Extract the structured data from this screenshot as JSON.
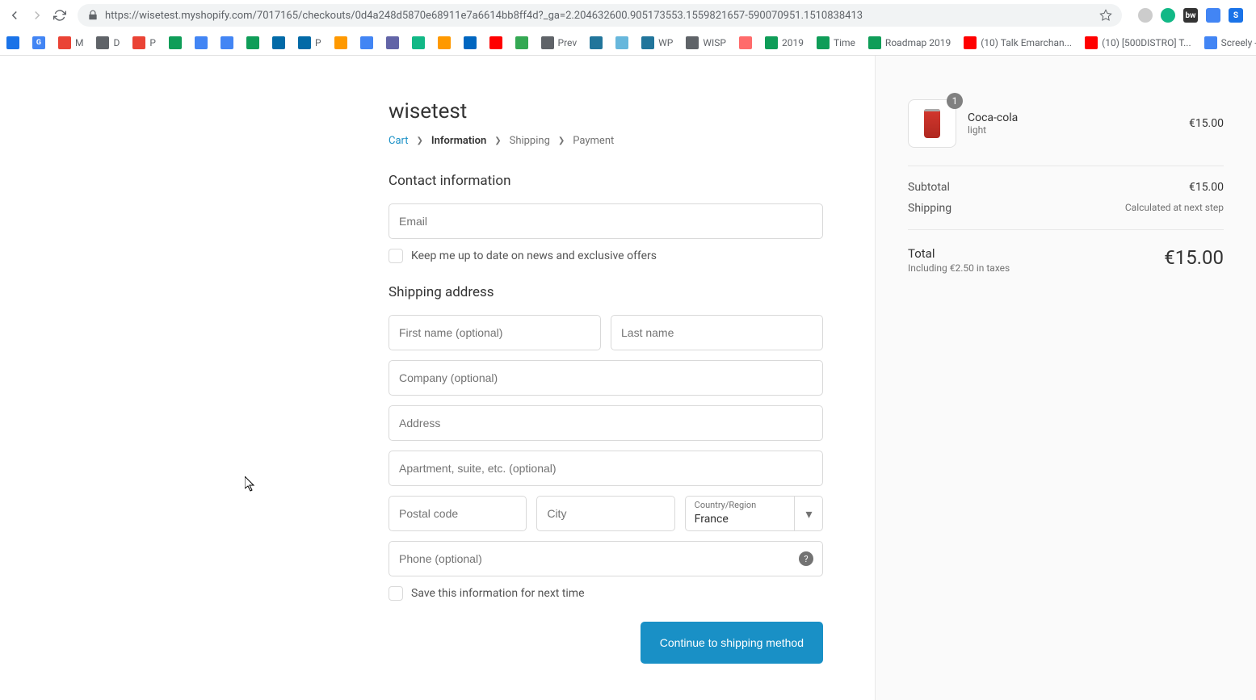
{
  "browser": {
    "url": "https://wisetest.myshopify.com/7017165/checkouts/0d4a248d5870e68911e7a6614bb8ff4d?_ga=2.204632600.905173553.1559821657-590070951.1510838413"
  },
  "bookmarks": [
    {
      "label": "",
      "color": "#1a73e8"
    },
    {
      "label": "",
      "color": "#4285f4",
      "text": "G"
    },
    {
      "label": "M",
      "color": "#ea4335"
    },
    {
      "label": "D",
      "color": "#5f6368"
    },
    {
      "label": "P",
      "color": "#ea4335"
    },
    {
      "label": "",
      "color": "#0f9d58"
    },
    {
      "label": "",
      "color": "#4285f4"
    },
    {
      "label": "",
      "color": "#4285f4"
    },
    {
      "label": "",
      "color": "#0f9d58"
    },
    {
      "label": "",
      "color": "#026aa7"
    },
    {
      "label": "P",
      "color": "#026aa7"
    },
    {
      "label": "",
      "color": "#ff9900"
    },
    {
      "label": "",
      "color": "#4285f4"
    },
    {
      "label": "",
      "color": "#6264a7"
    },
    {
      "label": "",
      "color": "#12b886"
    },
    {
      "label": "",
      "color": "#ff9900"
    },
    {
      "label": "",
      "color": "#0066c0"
    },
    {
      "label": "",
      "color": "#ff0000"
    },
    {
      "label": "",
      "color": "#34a853"
    },
    {
      "label": "Prev",
      "color": "#5f6368"
    },
    {
      "label": "",
      "color": "#21759b"
    },
    {
      "label": "",
      "color": "#67b7dc"
    },
    {
      "label": "WP",
      "color": "#21759b"
    },
    {
      "label": "WISP",
      "color": "#5f6368"
    },
    {
      "label": "",
      "color": "#ff6b6b"
    },
    {
      "label": "2019",
      "color": "#0f9d58"
    },
    {
      "label": "Time",
      "color": "#0f9d58"
    },
    {
      "label": "Roadmap 2019",
      "color": "#0f9d58"
    },
    {
      "label": "(10) Talk Emarchan...",
      "color": "#ff0000"
    },
    {
      "label": "(10) [500DISTRO] T...",
      "color": "#ff0000"
    },
    {
      "label": "Screely - Ge",
      "color": "#4285f4"
    }
  ],
  "store_title": "wisetest",
  "breadcrumb": {
    "cart": "Cart",
    "information": "Information",
    "shipping": "Shipping",
    "payment": "Payment"
  },
  "contact": {
    "title": "Contact information",
    "email_placeholder": "Email",
    "newsletter_label": "Keep me up to date on news and exclusive offers"
  },
  "shipping": {
    "title": "Shipping address",
    "first_name_placeholder": "First name (optional)",
    "last_name_placeholder": "Last name",
    "company_placeholder": "Company (optional)",
    "address_placeholder": "Address",
    "address2_placeholder": "Apartment, suite, etc. (optional)",
    "postal_placeholder": "Postal code",
    "city_placeholder": "City",
    "country_label": "Country/Region",
    "country_value": "France",
    "phone_placeholder": "Phone (optional)",
    "save_label": "Save this information for next time"
  },
  "actions": {
    "continue_label": "Continue to shipping method"
  },
  "order": {
    "product": {
      "name": "Coca-cola",
      "variant": "light",
      "qty": "1",
      "price": "€15.00"
    },
    "subtotal_label": "Subtotal",
    "subtotal_value": "€15.00",
    "shipping_label": "Shipping",
    "shipping_value": "Calculated at next step",
    "total_label": "Total",
    "total_value": "€15.00",
    "tax_note": "Including €2.50 in taxes"
  }
}
